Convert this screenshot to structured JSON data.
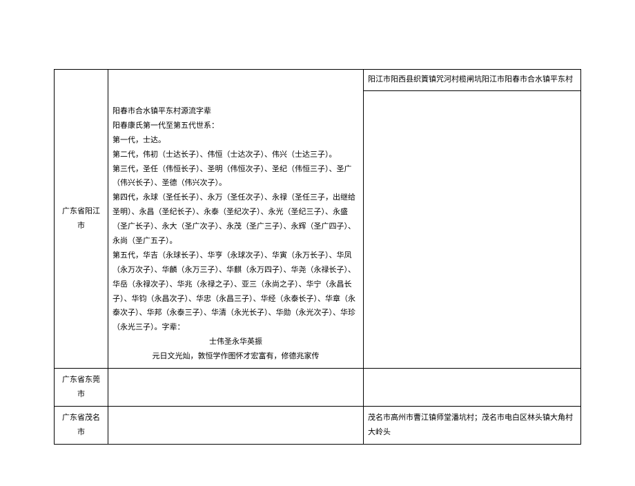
{
  "rows": [
    {
      "region": "广东省阳江市",
      "top_addr": "阳江市阳西县织篢镇咒河村榄闸坑阳江市阳春市合水镇平东村",
      "detail": {
        "l1": "阳春市合水镇平东村源流字辈",
        "l2": "阳春康氏第一代至第五代世系：",
        "l3": "第一代，士达。",
        "l4": "第二代，伟初（士达长子）、伟恒（士达次子）、伟兴（士达三子）。",
        "l5": "第三代，圣任（伟恒长子）、圣明（伟恒次子）、圣纪（伟恒三子）、圣广（伟兴长子）、圣德（伟兴次子）。",
        "l6": "第四代，永球（圣任长子）、永万（圣任次子）、永禄（圣任三子，出继给圣明）、永昌（圣纪长子）、永泰（圣纪次子）、永光（圣纪三子）、永盛（圣广长子）、永大（圣广次子）、永茂（圣广三子）、永辉（圣广四子）、永尚（圣广五子）。",
        "l7": "第五代，华吉（永球长子）、华亨（永球次子）、华寅（永万长子）、华凤（永万次子）、华麟（永万三子）、华麒（永万四子）、华尧（永禄长子）、华岳（永禄次子）、华兆（永禄之子）、亚三（永尚之子）、华宁（永昌长子）、华钧（永昌次子）、华忠（永昌三子）、华经（永泰长子）、华章（永泰次子）、华邦（永泰三子）、华清（永光长子）、华勋（永光次子）、华珍（永光三子）。字辈：",
        "c1": "士伟圣永华英振",
        "c2": "元日文光灿，敦恒学作图怀才宏富有，修德兆家传"
      }
    },
    {
      "region": "广东省东莞市",
      "detail": "",
      "addr": ""
    },
    {
      "region": "广东省茂名市",
      "detail": "",
      "addr": "茂名市高州市曹江镇师堂潘坑村；茂名市电白区林头镇大角村大岭头"
    }
  ]
}
